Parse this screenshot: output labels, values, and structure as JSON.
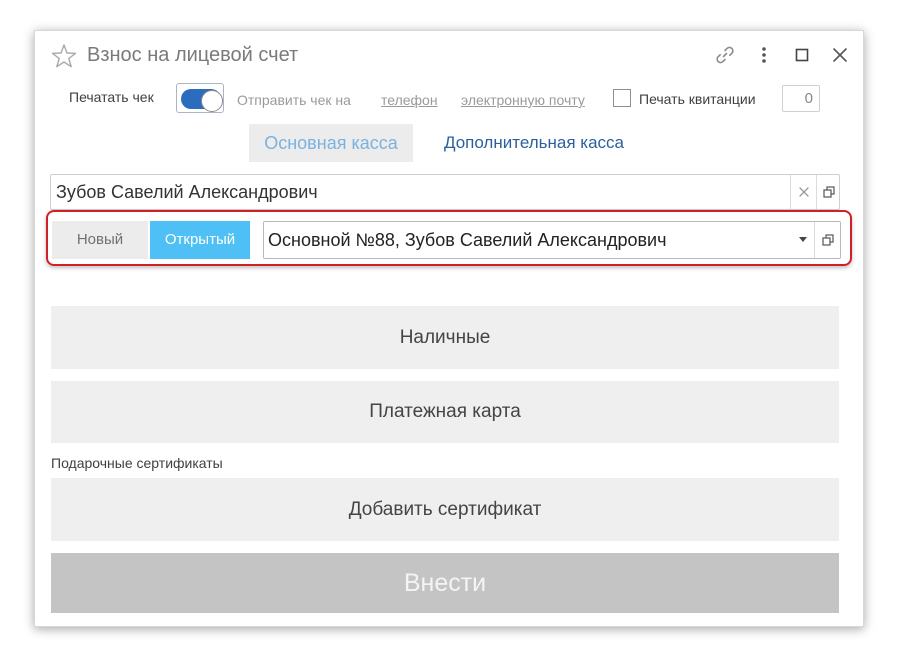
{
  "window": {
    "title": "Взнос на лицевой счет",
    "icons": [
      "star-icon",
      "link-icon",
      "more-vertical-icon",
      "maximize-icon",
      "close-icon"
    ]
  },
  "options": {
    "print_receipt_label": "Печатать чек",
    "print_receipt_enabled": true,
    "send_receipt_label": "Отправить чек на",
    "phone_link": "телефон",
    "email_link": "электронную почту",
    "print_receipts_label": "Печать квитанции",
    "print_receipts_checked": false,
    "copies_value": "0"
  },
  "tabs": {
    "main": "Основная касса",
    "extra": "Дополнительная касса",
    "active": "main"
  },
  "client": {
    "value": "Зубов Савелий Александрович"
  },
  "account": {
    "mode_new": "Новый",
    "mode_open": "Открытый",
    "active_mode": "open",
    "value": "Основной №88, Зубов Савелий Александрович"
  },
  "payment": {
    "cash_label": "Наличные",
    "card_label": "Платежная карта",
    "certificates_section": "Подарочные сертификаты",
    "add_certificate_label": "Добавить сертификат",
    "submit_label": "Внести"
  },
  "colors": {
    "accent_blue": "#4ec0f5",
    "toggle_blue": "#2c6cbf",
    "highlight_red": "#cf2027",
    "link_blue": "#2c5f9e"
  }
}
